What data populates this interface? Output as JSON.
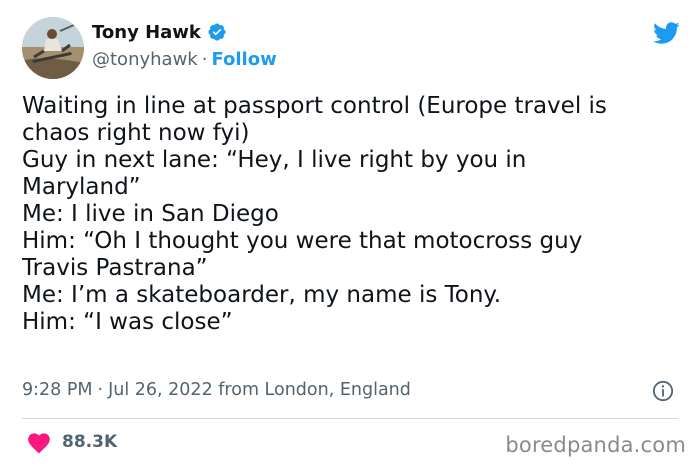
{
  "author": {
    "display_name": "Tony Hawk",
    "handle": "@tonyhawk",
    "separator": "·",
    "follow_label": "Follow",
    "verified": true
  },
  "tweet": {
    "lines": [
      "Waiting in line at passport control (Europe travel is",
      "chaos right now fyi)",
      "Guy in next lane: “Hey, I live right by you in",
      "Maryland”",
      "Me: I live in San Diego",
      "Him: “Oh I thought you were that motocross guy",
      "Travis Pastrana”",
      "Me: I’m a skateboarder, my name is Tony.",
      "Him: “I was close”"
    ],
    "time": "9:28 PM",
    "dot": "·",
    "date": "Jul 26, 2022 from London, England"
  },
  "engagement": {
    "like_count": "88.3K"
  },
  "watermark": "boredpanda.com",
  "colors": {
    "accent": "#1d9bf0",
    "heart": "#f91880",
    "muted": "#536471"
  },
  "icons": {
    "verified": "verified-badge-icon",
    "bird": "twitter-bird-icon",
    "info": "info-icon",
    "heart": "heart-icon"
  }
}
